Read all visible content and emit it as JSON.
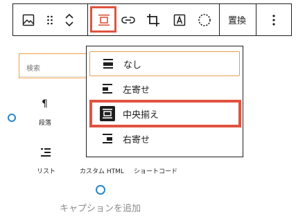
{
  "toolbar": {
    "replace_label": "置換",
    "icons": [
      "image-icon",
      "drag-handle-icon",
      "move-up-down-icon",
      "align-center-icon",
      "link-icon",
      "crop-icon",
      "text-overlay-icon",
      "circle-crop-icon",
      "more-options-icon"
    ],
    "accent_color": "#e0533f"
  },
  "inserter": {
    "search_placeholder": "検索",
    "blocks": [
      {
        "label": "段落",
        "icon": "paragraph-icon"
      },
      {
        "label": "リスト",
        "icon": "list-icon"
      },
      {
        "label": "カスタム HTML",
        "icon": "html-icon"
      },
      {
        "label": "ショートコード",
        "icon": "shortcode-icon"
      }
    ]
  },
  "align_menu": {
    "items": [
      {
        "label": "なし",
        "icon": "align-none-icon",
        "state": "focused"
      },
      {
        "label": "左寄せ",
        "icon": "align-left-icon"
      },
      {
        "label": "中央揃え",
        "icon": "align-center-icon",
        "state": "selected"
      },
      {
        "label": "右寄せ",
        "icon": "align-right-icon"
      }
    ]
  },
  "caption_placeholder": "キャプションを追加",
  "colors": {
    "highlight": "#e0533f",
    "focus": "#e0a04b",
    "link_blue": "#2a86c7"
  }
}
